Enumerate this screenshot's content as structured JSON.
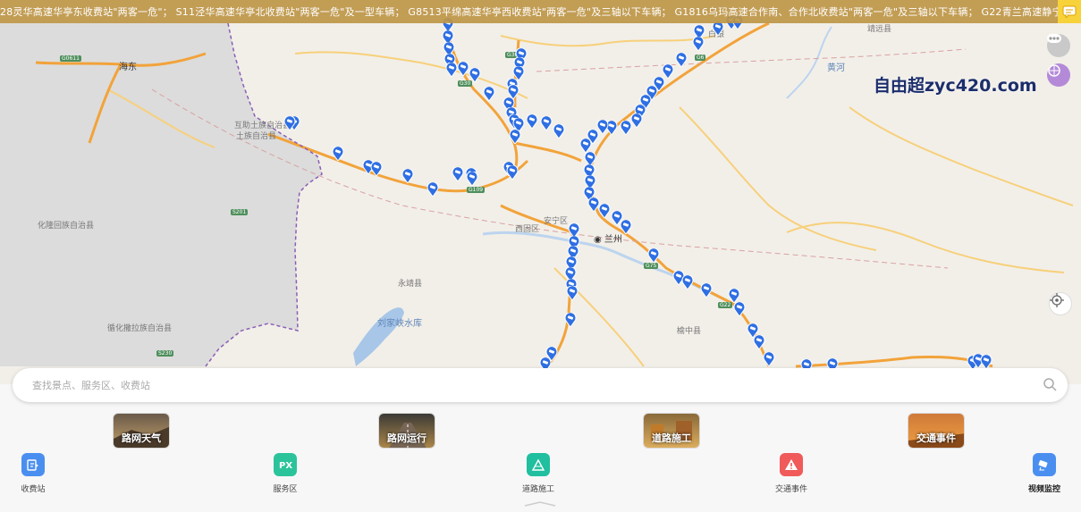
{
  "ticker": {
    "text": "28灵华高速华亭东收费站\"两客一危\"；  S11泾华高速华亭北收费站\"两客一危\"及一型车辆；  G8513平绵高速华亭西收费站\"两客一危\"及三轴以下车辆；  G1816乌玛高速合作南、合作北收费站\"两客一危\"及三轴以下车辆；  G22青兰高速静宁收费站\"两客一危\"；  S25静天高速静宁"
  },
  "watermark": "自由超zyc420.com",
  "map": {
    "labels": {
      "haidong": "海东",
      "tuzu": "互助土族自治县",
      "tuzu2": "土族自治县",
      "hualong": "化隆回族自治县",
      "xunhua": "循化撒拉族自治县",
      "yongjing": "永靖县",
      "liujiaxia": "刘家峡水库",
      "anning": "安宁区",
      "xigu": "西固区",
      "lanzhou": "兰州",
      "yuzhong": "榆中县",
      "huanghe": "黄河",
      "jingyuan": "靖远县",
      "baiyin": "白银"
    },
    "shields": {
      "g0611": "G0611",
      "g30a": "G30",
      "g30b": "G30",
      "g6": "G6",
      "s201": "S201",
      "s230": "S230",
      "g109": "G109",
      "g22": "G22",
      "g75": "G75"
    }
  },
  "search": {
    "placeholder": "查找景点、服务区、收费站"
  },
  "categories": [
    {
      "label": "路网天气",
      "color_top": "#6a5a4a",
      "color_bottom": "#c8a46a"
    },
    {
      "label": "路网运行",
      "color_top": "#3c3a36",
      "color_bottom": "#b08a4a"
    },
    {
      "label": "道路施工",
      "color_top": "#8a6a3a",
      "color_bottom": "#e0b060"
    },
    {
      "label": "交通事件",
      "color_top": "#d07a3a",
      "color_bottom": "#f0a040"
    }
  ],
  "quick_links": [
    {
      "label": "收费站",
      "icon": "toll-station-icon",
      "color": "#4a8ff0"
    },
    {
      "label": "服务区",
      "icon": "service-area-icon",
      "color": "#2bc49a"
    },
    {
      "label": "道路施工",
      "icon": "construction-icon",
      "color": "#1fbf9f"
    },
    {
      "label": "交通事件",
      "icon": "warning-icon",
      "color": "#f05a5a"
    },
    {
      "label": "视频监控",
      "icon": "camera-icon",
      "color": "#4a8ff0"
    }
  ],
  "colors": {
    "pin": "#2f6fe3",
    "highway": "#f2a33a",
    "road": "#f7d07a",
    "water": "#a7c6e8"
  }
}
